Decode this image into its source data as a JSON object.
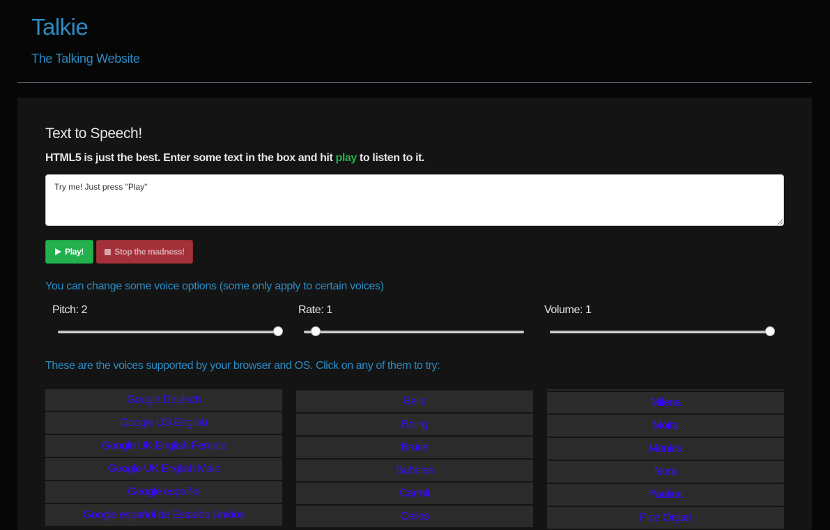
{
  "header": {
    "title": "Talkie",
    "subtitle": "The Talking Website"
  },
  "main": {
    "section_title": "Text to Speech!",
    "intro_before": "HTML5 is just the best. Enter some text in the box and hit ",
    "intro_play_word": "play",
    "intro_after": " to listen to it.",
    "text_input_value": "Try me! Just press \"Play\"",
    "play_button_label": "Play!",
    "stop_button_label": "Stop the madness!",
    "options_label": "You can change some voice options (some only apply to certain voices)",
    "voices_label": "These are the voices supported by your browser and OS. Click on any of them to try:"
  },
  "sliders": [
    {
      "key": "pitch",
      "label": "Pitch: 2",
      "value": 2,
      "min": 0,
      "max": 2
    },
    {
      "key": "rate",
      "label": "Rate: 1",
      "value": 1,
      "min": 0.5,
      "max": 10
    },
    {
      "key": "volume",
      "label": "Volume: 1",
      "value": 1,
      "min": 0,
      "max": 1
    }
  ],
  "voices": {
    "column1": [
      "Google Deutsch",
      "Google US English",
      "Google UK English Female",
      "Google UK English Male",
      "Google español",
      "Google español de Estados Unidos"
    ],
    "column2": [
      "Bells",
      "Boing",
      "Bruce",
      "Bubbles",
      "Carmit",
      "Cellos"
    ],
    "column3": [
      "Milena",
      "Moira",
      "Monica",
      "Nora",
      "Paulina",
      "Pipe Organ"
    ]
  },
  "colors": {
    "accent": "#2b8cc4",
    "play_green": "#22b14c",
    "stop_red": "#a4313a",
    "voice_link": "#3b0bff"
  },
  "icons": {
    "play": "play-icon",
    "stop": "stop-icon"
  }
}
